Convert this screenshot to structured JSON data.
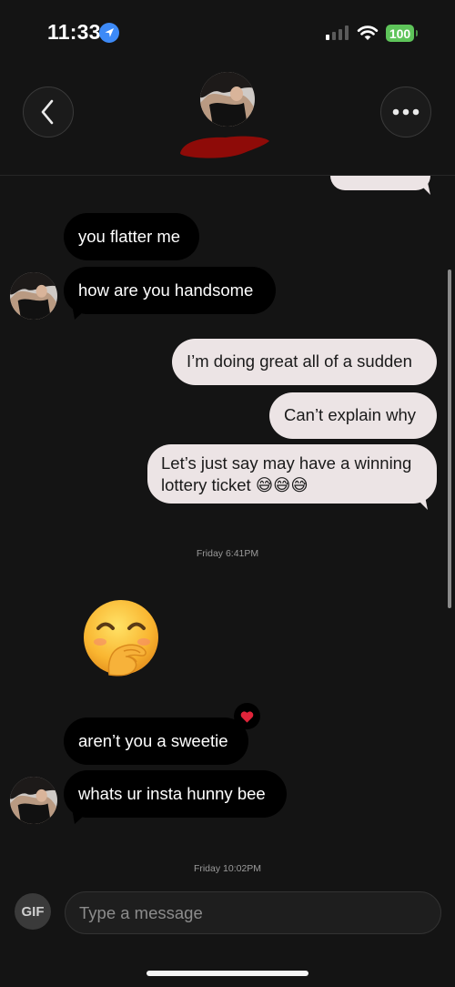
{
  "status_bar": {
    "time": "11:33",
    "battery": "100"
  },
  "header": {
    "back": "back",
    "more": "more options"
  },
  "messages": [
    {
      "from": "them",
      "text": "you flatter me"
    },
    {
      "from": "them",
      "text": "how are you handsome"
    },
    {
      "from": "me",
      "text": "I’m doing great all of a sudden"
    },
    {
      "from": "me",
      "text": "Can’t explain why"
    },
    {
      "from": "me",
      "text": "Let’s just say may have a winning lottery ticket 😅😅😅"
    },
    {
      "from": "them",
      "text": "🤭",
      "type": "emoji"
    },
    {
      "from": "them",
      "text": "aren’t you a sweetie",
      "reaction": "heart"
    },
    {
      "from": "them",
      "text": "whats ur insta hunny bee"
    }
  ],
  "timestamps": {
    "t1": "Friday 6:41PM",
    "t2": "Friday 10:02PM"
  },
  "composer": {
    "gif": "GIF",
    "placeholder": "Type a message"
  },
  "icons": [
    "location-arrow-icon",
    "signal-icon",
    "wifi-icon",
    "chevron-left-icon",
    "ellipsis-icon",
    "heart-icon"
  ],
  "colors": {
    "incoming_bubble": "#000000",
    "outgoing_bubble": "#ece4e5",
    "background": "#141414",
    "battery": "#5ec45a",
    "heart": "#e0243a"
  }
}
